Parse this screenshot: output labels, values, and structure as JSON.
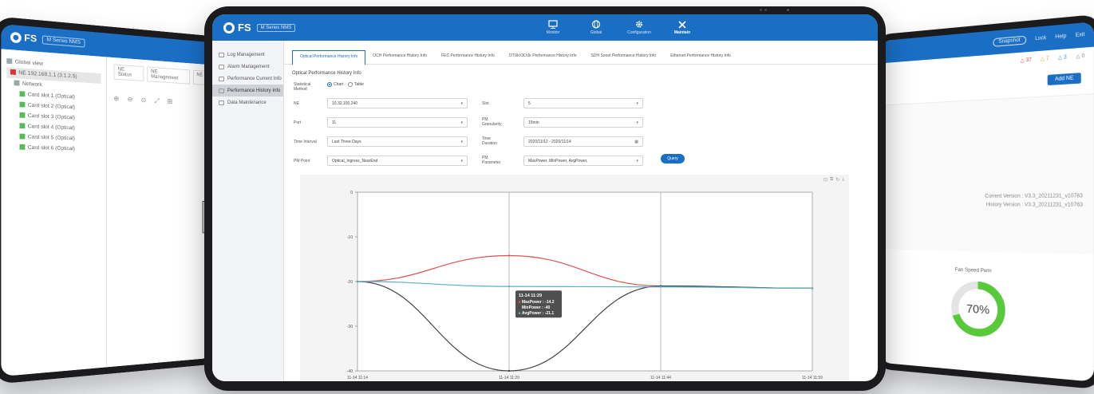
{
  "left_tablet": {
    "brand": "FS",
    "badge": "M Series NMS",
    "tree": [
      "Global view",
      "NE 192.168.1.1 (3.1.2.5)",
      "Network",
      "Card slot 1 (Optical)",
      "Card slot 2 (Optical)",
      "Card slot 3 (Optical)",
      "Card slot 4 (Optical)",
      "Card slot 5 (Optical)",
      "Card slot 6 (Optical)"
    ],
    "tabs": [
      "NE Status",
      "NE Management",
      "NE"
    ],
    "tools": [
      "⊕",
      "⊖",
      "⊙",
      "⤢",
      "⊞"
    ]
  },
  "right_tablet": {
    "header": [
      "Snapshot",
      "Lock",
      "Help",
      "Exit"
    ],
    "alarms": {
      "critical": "37",
      "major": "7",
      "minor": "3",
      "info": "0"
    },
    "add_button": "Add NE",
    "versions": [
      "Current Version : V3.3_20211231_v10763",
      "History Version : V3.3_20211231_v10763"
    ],
    "fan_label": "Fan Speed Pwm",
    "fan_value": "70%",
    "fan_percent": 70
  },
  "app": {
    "brand": "FS",
    "badge": "M Series NMS",
    "nav": [
      {
        "label": "Monitor",
        "icon": "monitor-icon"
      },
      {
        "label": "Global",
        "icon": "globe-icon"
      },
      {
        "label": "Configuration",
        "icon": "gear-icon"
      },
      {
        "label": "Maintain",
        "icon": "tools-icon",
        "active": true
      }
    ]
  },
  "sidebar": {
    "items": [
      {
        "label": "Log Management",
        "active": false
      },
      {
        "label": "Alarm Management",
        "active": false
      },
      {
        "label": "Performance Current Info",
        "active": false
      },
      {
        "label": "Performance History Info",
        "active": true
      },
      {
        "label": "Data Maintenance",
        "active": false
      }
    ]
  },
  "tabs": [
    {
      "label": "Optical Performance History Info",
      "active": true
    },
    {
      "label": "OCH Performance History Info"
    },
    {
      "label": "FEC Performance History Info"
    },
    {
      "label": "OTUk/ODUk Performance History Info"
    },
    {
      "label": "SDH Sonet Performance History Info"
    },
    {
      "label": "Ethernet Performance History Info"
    }
  ],
  "section_title": "Optical Performance History Info",
  "form": {
    "statistical_method_label": "Statistical Method",
    "radio_chart": "Chart",
    "radio_table": "Table",
    "ne_label": "NE",
    "ne_value": "10.32.100.240",
    "slot_label": "Slot",
    "slot_value": "5",
    "port_label": "Port",
    "port_value": "11",
    "granularity_label": "PM Granularity",
    "granularity_value": "15min",
    "time_interval_label": "Time Interval",
    "time_interval_value": "Last Three Days",
    "duration_label": "Time Duration",
    "duration_value": "2020/11/12 - 2020/11/14",
    "pm_point_label": "PM Point",
    "pm_point_value": "Optical_Ingress_NearEnd",
    "pm_parameter_label": "PM Parameter",
    "pm_parameter_value": "MaxPower, MinPower, AvgPower,",
    "query_button": "Query"
  },
  "chart_data": {
    "type": "line",
    "x": [
      "11-14 11:14",
      "11-14 11:29",
      "11-14 11:44",
      "11-14 11:59"
    ],
    "ylim": [
      -40,
      0
    ],
    "yticks": [
      "0",
      "-10",
      "-20",
      "-30",
      "-40"
    ],
    "series": [
      {
        "name": "MaxPower",
        "color": "#d9534f",
        "values": [
          -20,
          -14.2,
          -21,
          -21.5
        ]
      },
      {
        "name": "MinPower",
        "color": "#444444",
        "values": [
          -20,
          -40,
          -21,
          -21.5
        ]
      },
      {
        "name": "AvgPower",
        "color": "#5ab0c8",
        "values": [
          -20,
          -21.1,
          -21.2,
          -21.5
        ]
      }
    ],
    "tooltip": {
      "title": "11-14 11:29",
      "lines": [
        "MaxPower : -14.2",
        "MinPower : -40",
        "AvgPower : -21.1"
      ]
    },
    "toolbar": [
      "⊡",
      "⧉",
      "↻",
      "⤓"
    ]
  }
}
